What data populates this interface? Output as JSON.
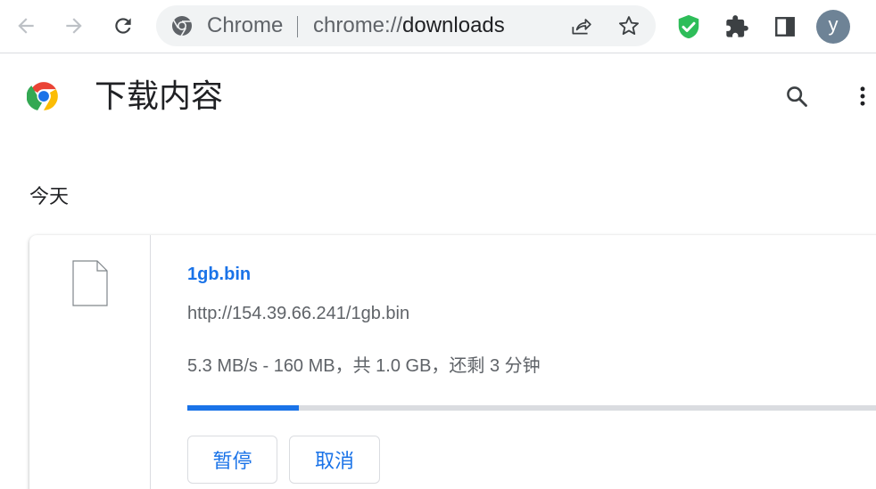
{
  "toolbar": {
    "site_name": "Chrome",
    "url_scheme": "chrome://",
    "url_host": "downloads",
    "avatar_letter": "y",
    "icons": {
      "back": "arrow-left-icon",
      "forward": "arrow-right-icon",
      "reload": "reload-icon",
      "share": "share-icon",
      "bookmark": "star-icon",
      "extension_shield": "shield-check-icon",
      "extensions": "puzzle-icon",
      "side_panel": "side-panel-icon"
    }
  },
  "header": {
    "title": "下载内容",
    "icons": {
      "logo": "chrome-logo-icon",
      "search": "search-icon",
      "menu": "more-vert-icon"
    }
  },
  "section": {
    "date_label": "今天"
  },
  "download": {
    "file_name": "1gb.bin",
    "url": "http://154.39.66.241/1gb.bin",
    "status": "5.3 MB/s - 160 MB，共 1.0 GB，还剩 3 分钟",
    "progress_fraction": 0.16,
    "pause_label": "暂停",
    "cancel_label": "取消",
    "file_icon": "file-icon"
  },
  "colors": {
    "accent": "#1a73e8",
    "shield": "#1db954",
    "avatar_bg": "#6e8396"
  }
}
